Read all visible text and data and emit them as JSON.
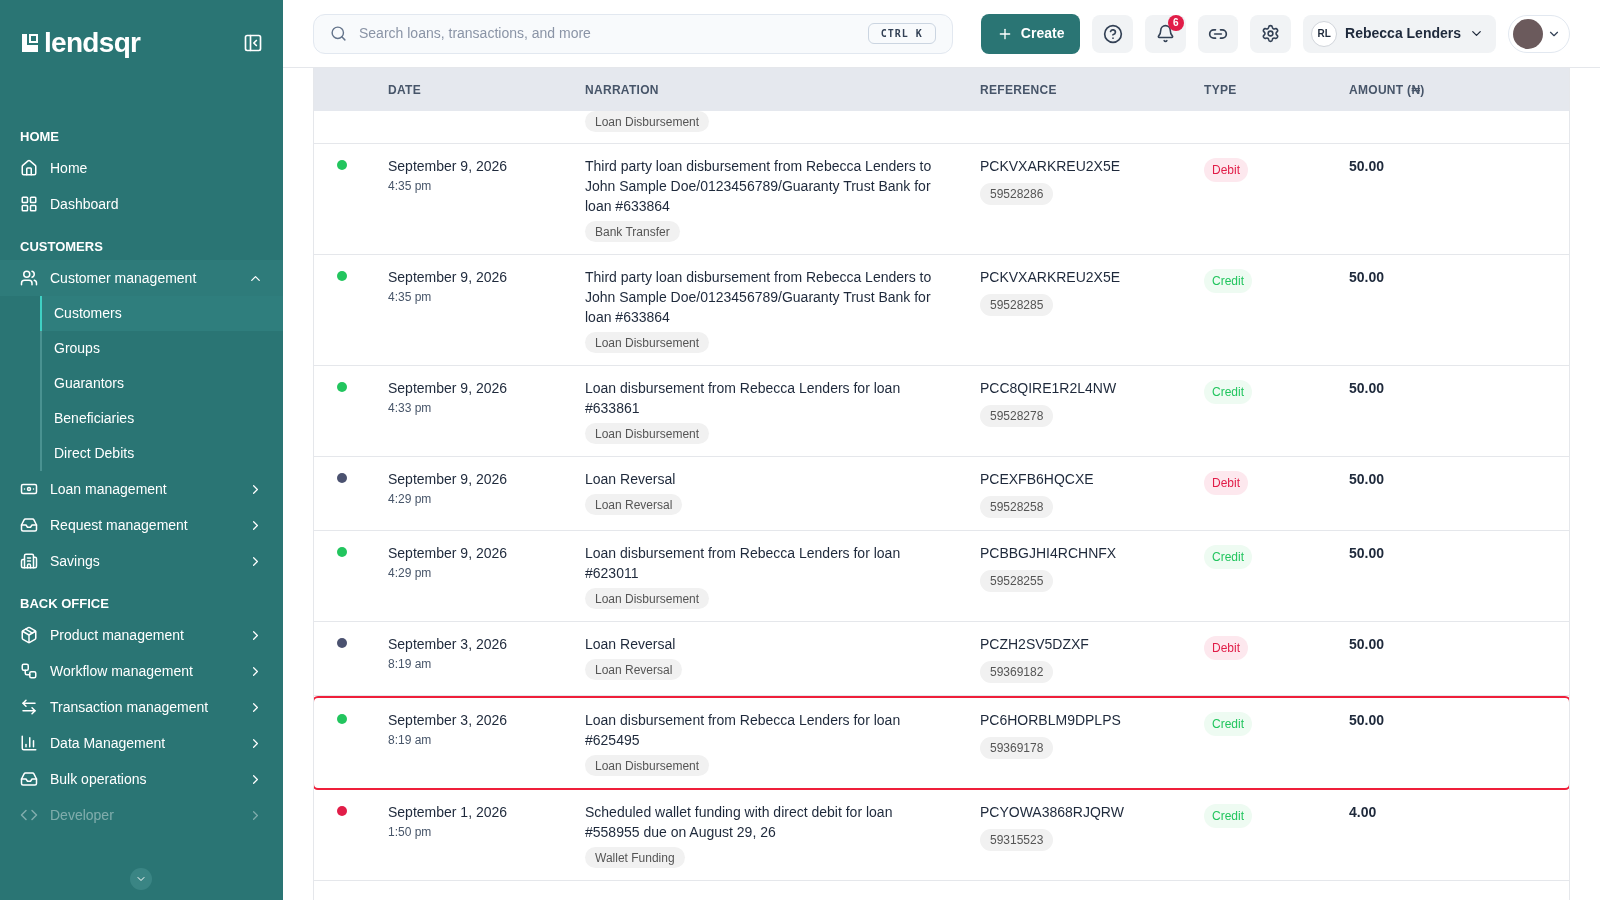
{
  "brand": {
    "name": "lendsqr"
  },
  "sidebar": {
    "sections": [
      {
        "title": "HOME",
        "items": [
          {
            "label": "Home",
            "selected": false,
            "disabled": false
          },
          {
            "label": "Dashboard",
            "selected": false,
            "disabled": false
          }
        ]
      },
      {
        "title": "CUSTOMERS",
        "items": [
          {
            "label": "Customer management",
            "selected": false,
            "disabled": false,
            "expanded": true,
            "children": [
              {
                "label": "Customers",
                "selected": true
              },
              {
                "label": "Groups",
                "selected": false
              },
              {
                "label": "Guarantors",
                "selected": false
              },
              {
                "label": "Beneficiaries",
                "selected": false
              },
              {
                "label": "Direct Debits",
                "selected": false
              }
            ]
          },
          {
            "label": "Loan management",
            "selected": false,
            "disabled": false,
            "expanded": false
          },
          {
            "label": "Request management",
            "selected": false,
            "disabled": false,
            "expanded": false
          },
          {
            "label": "Savings",
            "selected": false,
            "disabled": false,
            "expanded": false
          }
        ]
      },
      {
        "title": "BACK OFFICE",
        "items": [
          {
            "label": "Product management",
            "selected": false,
            "disabled": false,
            "expanded": false
          },
          {
            "label": "Workflow management",
            "selected": false,
            "disabled": false,
            "expanded": false
          },
          {
            "label": "Transaction management",
            "selected": false,
            "disabled": false,
            "expanded": false
          },
          {
            "label": "Data Management",
            "selected": false,
            "disabled": false,
            "expanded": false
          },
          {
            "label": "Bulk operations",
            "selected": false,
            "disabled": false,
            "expanded": false
          },
          {
            "label": "Developer",
            "selected": false,
            "disabled": true,
            "expanded": false
          }
        ]
      }
    ]
  },
  "topbar": {
    "search": {
      "placeholder": "Search loans, transactions, and more",
      "shortcut": "CTRL K"
    },
    "create_button": "Create",
    "notifications": "6",
    "user": {
      "initials": "RL",
      "name": "Rebecca Lenders"
    }
  },
  "table": {
    "columns": [
      "DATE",
      "NARRATION",
      "REFERENCE",
      "TYPE",
      "AMOUNT (₦)"
    ],
    "top_partial_tag": "Loan Disbursement",
    "rows": [
      {
        "color": "#22c55e",
        "date": "September 9, 2026",
        "time": "4:35 pm",
        "narration": "Third party loan disbursement from Rebecca Lenders to John Sample Doe/0123456789/Guaranty Trust Bank for loan #633864",
        "tag": "Bank Transfer",
        "reference": "PCKVXARKREU2X5E",
        "ref_id": "59528286",
        "type": {
          "label": "Debit",
          "kind": "debit"
        },
        "amount": "50.00",
        "highlighted": false
      },
      {
        "color": "#22c55e",
        "date": "September 9, 2026",
        "time": "4:35 pm",
        "narration": "Third party loan disbursement from Rebecca Lenders to John Sample Doe/0123456789/Guaranty Trust Bank for loan #633864",
        "tag": "Loan Disbursement",
        "reference": "PCKVXARKREU2X5E",
        "ref_id": "59528285",
        "type": {
          "label": "Credit",
          "kind": "credit"
        },
        "amount": "50.00",
        "highlighted": false
      },
      {
        "color": "#22c55e",
        "date": "September 9, 2026",
        "time": "4:33 pm",
        "narration": "Loan disbursement from Rebecca Lenders for loan #633861",
        "tag": "Loan Disbursement",
        "reference": "PCC8QIRE1R2L4NW",
        "ref_id": "59528278",
        "type": {
          "label": "Credit",
          "kind": "credit"
        },
        "amount": "50.00",
        "highlighted": false
      },
      {
        "color": "#4b5270",
        "date": "September 9, 2026",
        "time": "4:29 pm",
        "narration": "Loan Reversal",
        "tag": "Loan Reversal",
        "reference": "PCEXFB6HQCXE",
        "ref_id": "59528258",
        "type": {
          "label": "Debit",
          "kind": "debit"
        },
        "amount": "50.00",
        "highlighted": false
      },
      {
        "color": "#22c55e",
        "date": "September 9, 2026",
        "time": "4:29 pm",
        "narration": "Loan disbursement from Rebecca Lenders for loan #623011",
        "tag": "Loan Disbursement",
        "reference": "PCBBGJHI4RCHNFX",
        "ref_id": "59528255",
        "type": {
          "label": "Credit",
          "kind": "credit"
        },
        "amount": "50.00",
        "highlighted": false
      },
      {
        "color": "#4b5270",
        "date": "September 3, 2026",
        "time": "8:19 am",
        "narration": "Loan Reversal",
        "tag": "Loan Reversal",
        "reference": "PCZH2SV5DZXF",
        "ref_id": "59369182",
        "type": {
          "label": "Debit",
          "kind": "debit"
        },
        "amount": "50.00",
        "highlighted": false
      },
      {
        "color": "#22c55e",
        "date": "September 3, 2026",
        "time": "8:19 am",
        "narration": "Loan disbursement from Rebecca Lenders for loan #625495",
        "tag": "Loan Disbursement",
        "reference": "PC6HORBLM9DPLPS",
        "ref_id": "59369178",
        "type": {
          "label": "Credit",
          "kind": "credit"
        },
        "amount": "50.00",
        "highlighted": true
      },
      {
        "color": "#e11d48",
        "date": "September 1, 2026",
        "time": "1:50 pm",
        "narration": "Scheduled wallet funding with direct debit for loan #558955 due on August 29, 26",
        "tag": "Wallet Funding",
        "reference": "PCYOWA3868RJQRW",
        "ref_id": "59315523",
        "type": {
          "label": "Credit",
          "kind": "credit"
        },
        "amount": "4.00",
        "highlighted": false
      }
    ]
  }
}
